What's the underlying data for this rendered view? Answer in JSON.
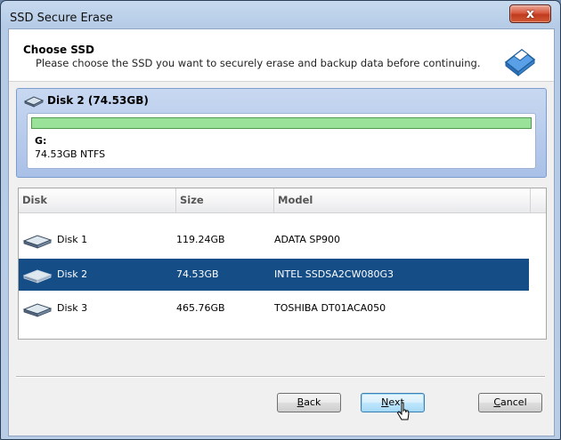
{
  "window": {
    "title": "SSD Secure Erase",
    "close_label": "x"
  },
  "header": {
    "title": "Choose SSD",
    "description": "Please choose the SSD you want to securely erase and backup data before continuing."
  },
  "selected_disk": {
    "title": "Disk 2 (74.53GB)",
    "partition": {
      "letter": "G:",
      "info": "74.53GB NTFS",
      "used_fraction": 1.0
    }
  },
  "table": {
    "columns": [
      "Disk",
      "Size",
      "Model"
    ],
    "rows": [
      {
        "name": "Disk 1",
        "size": "119.24GB",
        "model": "ADATA SP900",
        "selected": false
      },
      {
        "name": "Disk 2",
        "size": "74.53GB",
        "model": "INTEL SSDSA2CW080G3",
        "selected": true
      },
      {
        "name": "Disk 3",
        "size": "465.76GB",
        "model": "TOSHIBA DT01ACA050",
        "selected": false
      }
    ]
  },
  "buttons": {
    "back": {
      "accel": "B",
      "rest": "ack"
    },
    "next": {
      "accel": "N",
      "rest": "ext"
    },
    "cancel": {
      "accel": "C",
      "rest": "ancel"
    }
  },
  "colors": {
    "selection": "#154d86",
    "partition_fill": "#9ae19a",
    "close_button": "#c03b1f"
  },
  "icons": {
    "header": "eraser-icon",
    "disk": "disk-drive-icon",
    "cursor": "mouse-pointer-icon"
  }
}
